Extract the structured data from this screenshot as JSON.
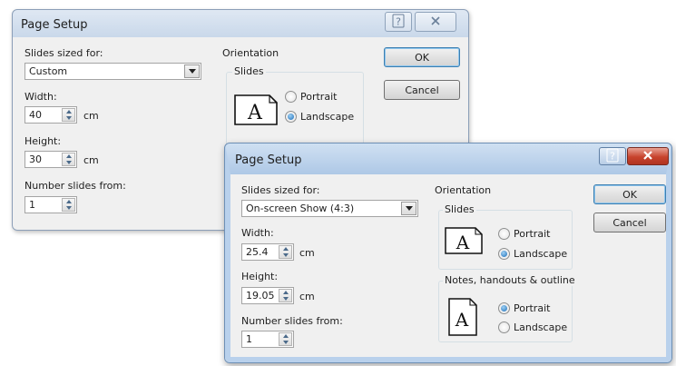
{
  "dialog1": {
    "title": "Page Setup",
    "slides_sized_for_label": "Slides sized for:",
    "slides_sized_for_value": "Custom",
    "width_label": "Width:",
    "width_value": "40",
    "width_unit": "cm",
    "height_label": "Height:",
    "height_value": "30",
    "height_unit": "cm",
    "number_slides_label": "Number slides from:",
    "number_slides_value": "1",
    "orientation_label": "Orientation",
    "slides_group_label": "Slides",
    "portrait_label": "Portrait",
    "landscape_label": "Landscape",
    "slides_orientation_selected": "Landscape",
    "ok_label": "OK",
    "cancel_label": "Cancel"
  },
  "dialog2": {
    "title": "Page Setup",
    "slides_sized_for_label": "Slides sized for:",
    "slides_sized_for_value": "On-screen Show (4:3)",
    "width_label": "Width:",
    "width_value": "25.4",
    "width_unit": "cm",
    "height_label": "Height:",
    "height_value": "19.05",
    "height_unit": "cm",
    "number_slides_label": "Number slides from:",
    "number_slides_value": "1",
    "orientation_label": "Orientation",
    "slides_group_label": "Slides",
    "slides_portrait_label": "Portrait",
    "slides_landscape_label": "Landscape",
    "slides_orientation_selected": "Landscape",
    "notes_group_label": "Notes, handouts & outline",
    "notes_portrait_label": "Portrait",
    "notes_landscape_label": "Landscape",
    "notes_orientation_selected": "Portrait",
    "ok_label": "OK",
    "cancel_label": "Cancel"
  },
  "icons": {
    "help": "help-icon",
    "close": "close-icon",
    "dropdown": "chevron-down-icon",
    "landscape_page": "landscape-page-icon",
    "portrait_page": "portrait-page-icon"
  },
  "colors": {
    "accent": "#1b6eb9",
    "close_button": "#c7432d",
    "dialog_face": "#f0f0f0"
  }
}
